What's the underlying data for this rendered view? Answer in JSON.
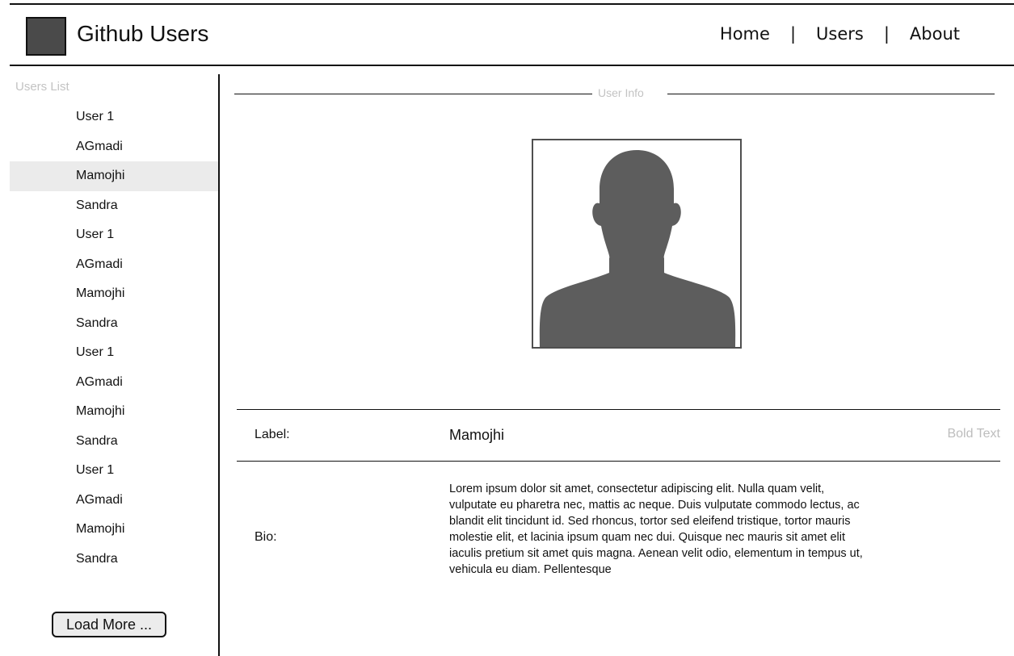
{
  "app": {
    "title": "Github Users"
  },
  "nav": {
    "home": "Home",
    "separator": "|",
    "users": "Users",
    "about": "About"
  },
  "sidebar": {
    "title": "Users List",
    "selected_index": 2,
    "users": [
      "User 1",
      "AGmadi",
      "Mamojhi",
      "Sandra",
      "User 1",
      "AGmadi",
      "Mamojhi",
      "Sandra",
      "User 1",
      "AGmadi",
      "Mamojhi",
      "Sandra",
      "User 1",
      "AGmadi",
      "Mamojhi",
      "Sandra"
    ],
    "load_more_label": "Load More ..."
  },
  "user_info": {
    "legend": "User Info",
    "avatar_icon": "user-silhouette-icon",
    "name_label": "Label:",
    "name_value": "Mamojhi",
    "name_aside": "Bold Text",
    "bio_label": "Bio:",
    "bio_text": "Lorem ipsum dolor sit amet, consectetur adipiscing elit. Nulla quam velit, vulputate eu pharetra nec, mattis ac neque. Duis vulputate commodo lectus, ac blandit elit tincidunt id. Sed rhoncus, tortor sed eleifend tristique, tortor mauris molestie elit, et lacinia ipsum quam nec dui. Quisque nec mauris sit amet elit iaculis pretium sit amet quis magna. Aenean velit odio, elementum in tempus ut, vehicula eu diam. Pellentesque"
  },
  "colors": {
    "avatar": "#5d5d5d",
    "selected_row": "#ebebeb",
    "muted_text": "#c3c3c3",
    "logo": "#4a4a4a"
  }
}
